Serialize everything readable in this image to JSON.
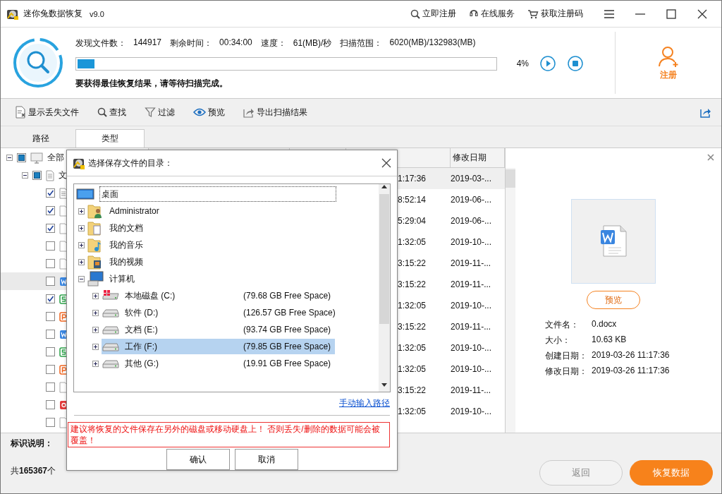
{
  "app": {
    "title": "迷你兔数据恢复",
    "version": "v9.0",
    "links": [
      {
        "label": "立即注册"
      },
      {
        "label": "在线服务"
      },
      {
        "label": "获取注册码"
      }
    ]
  },
  "scan": {
    "stats": [
      {
        "label": "发现文件数：",
        "value": "144917"
      },
      {
        "label": "剩余时间：",
        "value": "00:34:00"
      },
      {
        "label": "速度：",
        "value": "61(MB)/秒"
      },
      {
        "label": "扫描范围：",
        "value": "6020(MB)/132983(MB)"
      }
    ],
    "level": 0.04,
    "percent": "4%",
    "message": "要获得最佳恢复结果，请等待扫描完成。",
    "register": "注册"
  },
  "toolbar": [
    {
      "label": "显示丢失文件"
    },
    {
      "label": "查找"
    },
    {
      "label": "过滤"
    },
    {
      "label": "预览"
    },
    {
      "label": "导出扫描结果"
    }
  ],
  "tabs": [
    {
      "label": "路径",
      "selected": false
    },
    {
      "label": "类型",
      "selected": true
    }
  ],
  "tree": {
    "label": "全部",
    "partial": true,
    "expanded": true,
    "children": [
      {
        "label": "文",
        "partial": true,
        "expanded": true,
        "children": [
          {
            "checked": true,
            "kind": "text",
            "selected": false
          },
          {
            "checked": true,
            "kind": "blank",
            "selected": false
          },
          {
            "checked": true,
            "kind": "blank",
            "selected": false
          },
          {
            "checked": false,
            "kind": "blank",
            "selected": false
          },
          {
            "checked": false,
            "kind": "blank",
            "selected": false
          },
          {
            "checked": false,
            "kind": "word",
            "selected": true
          },
          {
            "checked": true,
            "kind": "sheet",
            "selected": false
          },
          {
            "checked": false,
            "kind": "slide",
            "selected": false
          },
          {
            "checked": false,
            "kind": "word",
            "selected": false
          },
          {
            "checked": false,
            "kind": "sheet",
            "selected": false
          },
          {
            "checked": false,
            "kind": "slide",
            "selected": false
          },
          {
            "checked": false,
            "kind": "blank",
            "selected": false
          },
          {
            "checked": false,
            "kind": "pdf",
            "selected": false
          },
          {
            "checked": false,
            "kind": "blank",
            "selected": false
          }
        ]
      }
    ]
  },
  "table": {
    "date_header": "修改日期",
    "rows": [
      {
        "time": "1:17:36",
        "date": "2019-03-...",
        "selected": true
      },
      {
        "time": "8:52:14",
        "date": "2019-06-...",
        "selected": false
      },
      {
        "time": "5:29:04",
        "date": "2019-06-...",
        "selected": false
      },
      {
        "time": "1:32:05",
        "date": "2019-10-...",
        "selected": false
      },
      {
        "time": "3:15:22",
        "date": "2019-11-...",
        "selected": false
      },
      {
        "time": "3:15:22",
        "date": "2019-11-...",
        "selected": false
      },
      {
        "time": "1:32:05",
        "date": "2019-10-...",
        "selected": false
      },
      {
        "time": "3:15:22",
        "date": "2019-11-...",
        "selected": false
      },
      {
        "time": "1:32:05",
        "date": "2019-10-...",
        "selected": false
      },
      {
        "time": "1:32:05",
        "date": "2019-10-...",
        "selected": false
      },
      {
        "time": "3:15:22",
        "date": "2019-11-...",
        "selected": false
      },
      {
        "time": "1:32:05",
        "date": "2019-10-...",
        "selected": false
      }
    ]
  },
  "preview": {
    "button": "预览",
    "fields": [
      {
        "label": "文件名：",
        "value": "0.docx"
      },
      {
        "label": "大小：",
        "value": "10.63 KB"
      },
      {
        "label": "创建日期：",
        "value": "2019-03-26 11:17:36"
      },
      {
        "label": "修改日期：",
        "value": "2019-03-26 11:17:36"
      }
    ]
  },
  "legend_label": "标识说明：",
  "summary": "共**165367**个",
  "actions": [
    {
      "label": "返回",
      "disabled": true
    },
    {
      "label": "恢复数据",
      "disabled": false
    }
  ],
  "dialog": {
    "title": "选择保存文件的目录：",
    "tree": [
      {
        "label": "桌面",
        "kind": "desktop",
        "selected": false,
        "focused": true,
        "children": [
          {
            "label": "Administrator",
            "kind": "user",
            "expanded": false,
            "selected": false
          },
          {
            "label": "我的文档",
            "kind": "documents",
            "expanded": false,
            "selected": false
          },
          {
            "label": "我的音乐",
            "kind": "music",
            "expanded": false,
            "selected": false
          },
          {
            "label": "我的视频",
            "kind": "video",
            "expanded": false,
            "selected": false
          },
          {
            "label": "计算机",
            "kind": "computer",
            "expanded": true,
            "selected": false,
            "children": [
              {
                "label": "本地磁盘 (C:)",
                "kind": "system-drive",
                "free": "(79.68 GB Free Space)",
                "expanded": false,
                "selected": false
              },
              {
                "label": "软件 (D:)",
                "kind": "drive",
                "free": "(126.57 GB Free Space)",
                "expanded": false,
                "selected": false
              },
              {
                "label": "文档 (E:)",
                "kind": "drive",
                "free": "(93.74 GB Free Space)",
                "expanded": false,
                "selected": false
              },
              {
                "label": "工作 (F:)",
                "kind": "drive",
                "free": "(79.85 GB Free Space)",
                "expanded": false,
                "selected": true
              },
              {
                "label": "其他 (G:)",
                "kind": "drive",
                "free": "(19.91 GB Free Space)",
                "expanded": false,
                "selected": false
              }
            ]
          }
        ]
      }
    ],
    "link": "手动输入路径",
    "warning": "建议将恢复的文件保存在另外的磁盘或移动硬盘上！ 否则丢失/删除的数据可能会被覆盖！",
    "buttons": [
      "确认",
      "取消"
    ]
  }
}
